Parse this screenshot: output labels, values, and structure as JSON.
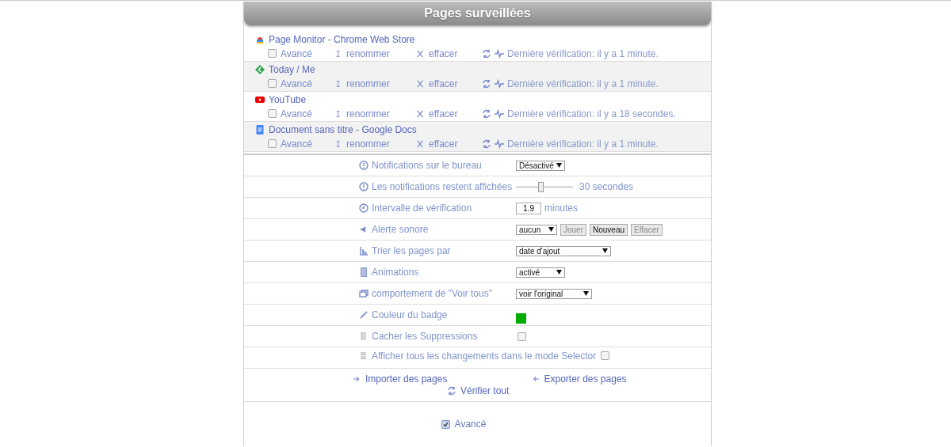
{
  "header": {
    "title": "Pages surveillées"
  },
  "pages": [
    {
      "title": "Page Monitor - Chrome Web Store",
      "advanced": false,
      "advanced_label": "Avancé",
      "rename": "renommer",
      "delete": "effacer",
      "status": "Dernière vérification: il y a 1 minute."
    },
    {
      "title": "Today / Me",
      "advanced": false,
      "advanced_label": "Avancé",
      "rename": "renommer",
      "delete": "effacer",
      "status": "Dernière vérification: il y a 1 minute."
    },
    {
      "title": "YouTube",
      "advanced": false,
      "advanced_label": "Avancé",
      "rename": "renommer",
      "delete": "effacer",
      "status": "Dernière vérification: il y a 18 secondes."
    },
    {
      "title": "Document sans titre - Google Docs",
      "advanced": false,
      "advanced_label": "Avancé",
      "rename": "renommer",
      "delete": "effacer",
      "status": "Dernière vérification: il y a 1 minute."
    }
  ],
  "settings": [
    {
      "kind": "select",
      "label": "Notifications sur le bureau",
      "value": "Désactivé"
    },
    {
      "kind": "slider",
      "label": "Les notifications restent affichées",
      "level": 0.45,
      "reading": "30 secondes"
    },
    {
      "kind": "number",
      "label": "Intervalle de vérification",
      "value": "1.9",
      "unit": "minutes"
    },
    {
      "kind": "sound",
      "label": "Alerte sonore",
      "value": "aucun",
      "buttons": [
        {
          "label": "Jouer",
          "disabled": true
        },
        {
          "label": "Nouveau",
          "disabled": false
        },
        {
          "label": "Effacer",
          "disabled": true
        }
      ]
    },
    {
      "kind": "select",
      "label": "Trier les pages par",
      "value": "date d'ajout"
    },
    {
      "kind": "select",
      "label": "Animations",
      "value": "activé"
    },
    {
      "kind": "select",
      "label": "comportement de \"Voir tous\"",
      "value": "voir l'original"
    },
    {
      "kind": "color",
      "label": "Couleur du badge",
      "color": "#00aa00"
    },
    {
      "kind": "checkbox",
      "label": "Cacher les Suppressions",
      "checked": false
    },
    {
      "kind": "inline-checkbox",
      "label": "Afficher tous les changements dans le mode Selector",
      "checked": false
    }
  ],
  "actions": {
    "import": "Importer des pages",
    "export": "Exporter des pages",
    "check_all": "Vérifier tout"
  },
  "advanced": {
    "label": "Avancé",
    "checked": true
  }
}
